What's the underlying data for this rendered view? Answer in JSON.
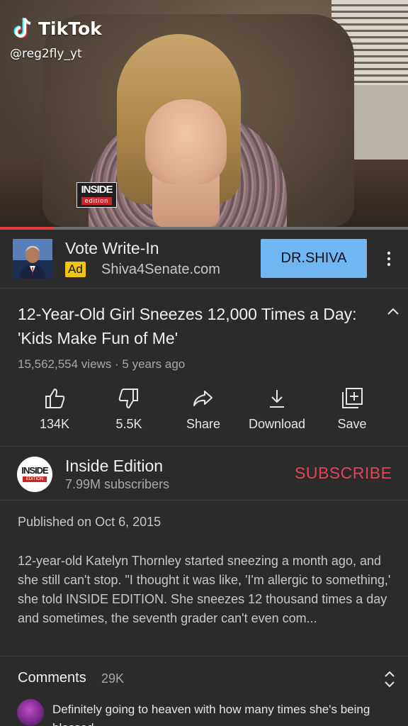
{
  "overlay": {
    "app_name": "TikTok",
    "username": "@reg2fly_yt"
  },
  "video": {
    "logo_top": "INSIDE",
    "logo_bottom": "edition",
    "progress_fraction": 0.13
  },
  "ad": {
    "title": "Vote Write-In",
    "badge": "Ad",
    "url": "Shiva4Senate.com",
    "button_label": "DR.SHIVA"
  },
  "video_info": {
    "title": "12-Year-Old Girl Sneezes 12,000 Times a Day: 'Kids Make Fun of Me'",
    "meta": "15,562,554 views · 5 years ago"
  },
  "actions": [
    {
      "label": "134K",
      "icon": "thumbs-up-icon"
    },
    {
      "label": "5.5K",
      "icon": "thumbs-down-icon"
    },
    {
      "label": "Share",
      "icon": "share-icon"
    },
    {
      "label": "Download",
      "icon": "download-icon"
    },
    {
      "label": "Save",
      "icon": "save-to-playlist-icon"
    }
  ],
  "channel": {
    "name": "Inside Edition",
    "subscribers": "7.99M subscribers",
    "logo_top": "INSIDE",
    "logo_bottom": "EDITION",
    "subscribe_label": "SUBSCRIBE"
  },
  "description": {
    "published": "Published on Oct 6, 2015",
    "text": "12-year-old Katelyn Thornley started sneezing a month ago, and she still can't stop. \"I thought it was like, 'I'm allergic to something,' she told INSIDE EDITION. She sneezes 12 thousand times a day and sometimes, the seventh grader can't even com..."
  },
  "comments": {
    "label": "Comments",
    "count": "29K",
    "top_comment": "Definitely going to heaven with how many times she's being blessed"
  },
  "colors": {
    "background": "#2b2b2b",
    "subscribe": "#e0445a",
    "ad_button": "#6fb6f2",
    "ad_badge": "#f1c40f",
    "progress": "#e53935"
  }
}
